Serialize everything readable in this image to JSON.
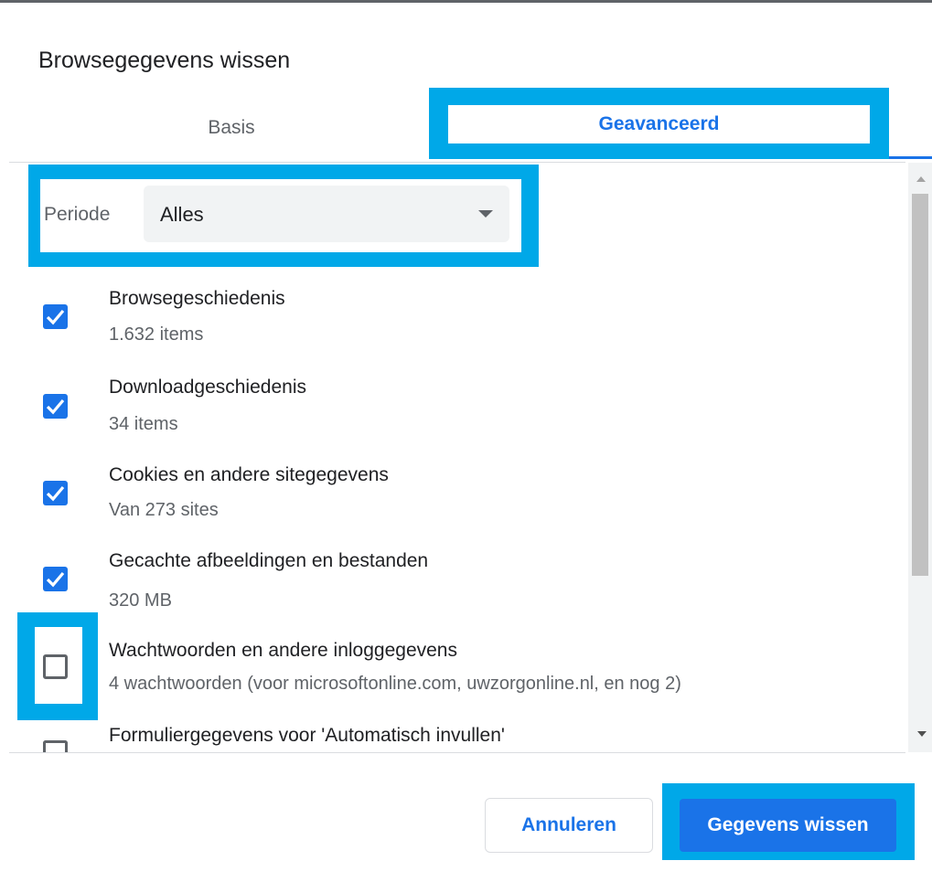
{
  "dialog": {
    "title": "Browsegegevens wissen",
    "tabs": [
      {
        "label": "Basis",
        "active": false
      },
      {
        "label": "Geavanceerd",
        "active": true
      }
    ]
  },
  "period": {
    "label": "Periode",
    "value": "Alles"
  },
  "items": [
    {
      "title": "Browsegeschiedenis",
      "subtitle": "1.632 items",
      "checked": true
    },
    {
      "title": "Downloadgeschiedenis",
      "subtitle": "34 items",
      "checked": true
    },
    {
      "title": "Cookies en andere sitegegevens",
      "subtitle": "Van 273 sites",
      "checked": true
    },
    {
      "title": "Gecachte afbeeldingen en bestanden",
      "subtitle": "320 MB",
      "checked": true
    },
    {
      "title": "Wachtwoorden en andere inloggegevens",
      "subtitle": "4 wachtwoorden (voor microsoftonline.com, uwzorgonline.nl, en nog 2)",
      "checked": false
    },
    {
      "title": "Formuliergegevens voor 'Automatisch invullen'",
      "subtitle": "",
      "checked": false
    }
  ],
  "buttons": {
    "cancel": "Annuleren",
    "clear": "Gegevens wissen"
  },
  "colors": {
    "accent": "#1a73e8",
    "highlight": "#00a8e8"
  }
}
